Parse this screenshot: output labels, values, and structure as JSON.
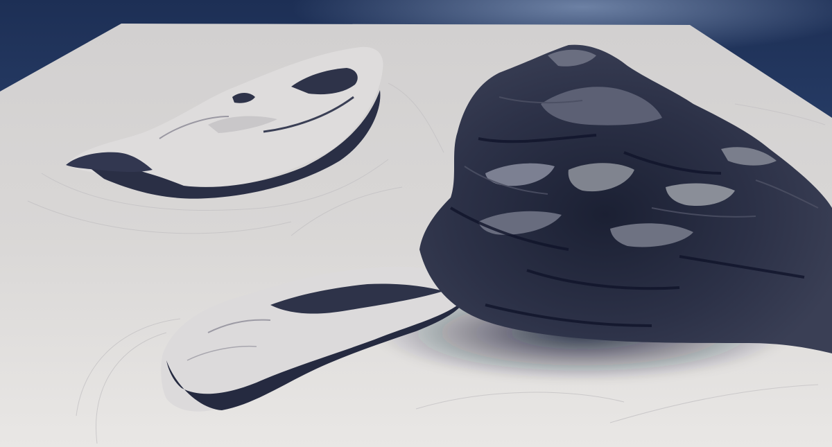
{
  "scene": {
    "subject": "3d-terrain-render",
    "colors": {
      "sky_top": "#1d2f55",
      "sky_mid": "#3d5a8c",
      "sky_glow": "#8fa4c6",
      "ground_light": "#e9e7e5",
      "ground_mid": "#d9d7d6",
      "ground_far": "#d2d0d0",
      "rock_dark": "#1b2033",
      "rock_mid": "#3a3f55",
      "rock_light": "#6a6e80",
      "shadow": "#141a33"
    }
  }
}
